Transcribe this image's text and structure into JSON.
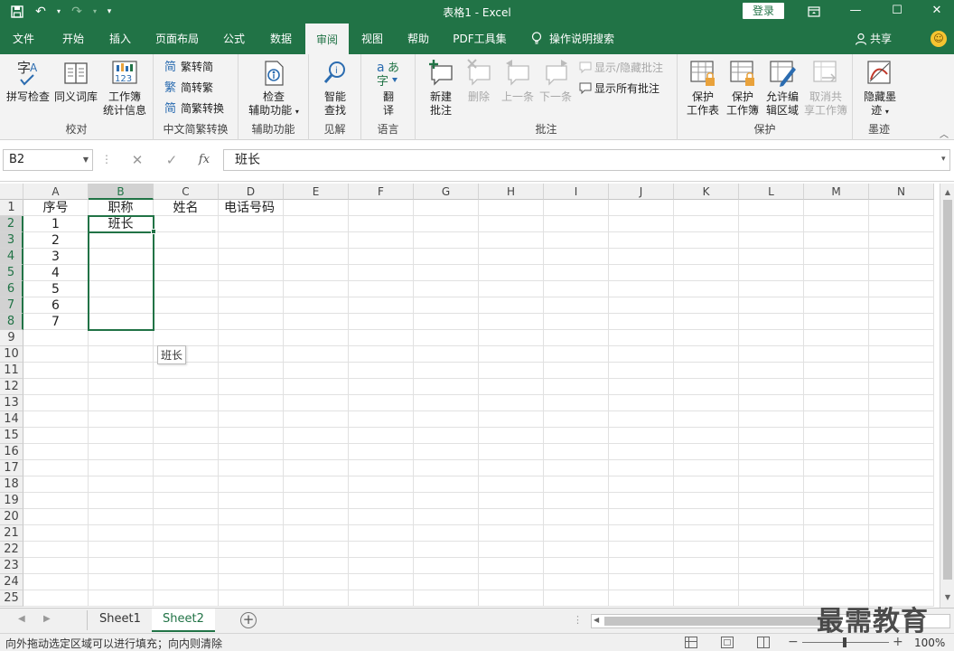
{
  "titlebar": {
    "title": "表格1 - Excel",
    "login": "登录"
  },
  "tabs": [
    {
      "label": "文件"
    },
    {
      "label": "开始"
    },
    {
      "label": "插入"
    },
    {
      "label": "页面布局"
    },
    {
      "label": "公式"
    },
    {
      "label": "数据"
    },
    {
      "label": "审阅",
      "active": true
    },
    {
      "label": "视图"
    },
    {
      "label": "帮助"
    },
    {
      "label": "PDF工具集"
    },
    {
      "label": "操作说明搜索"
    }
  ],
  "share": "共享",
  "ribbon": {
    "proofing": {
      "label": "校对",
      "spell1": "拼写检查",
      "thesaurus": "同义词库",
      "stats1": "工作簿",
      "stats2": "统计信息"
    },
    "chinese": {
      "label": "中文简繁转换",
      "to_trad": "繁转简",
      "to_simp": "简转繁",
      "convert": "简繁转换"
    },
    "access": {
      "label": "辅助功能",
      "check1": "检查",
      "check2": "辅助功能"
    },
    "insights": {
      "label": "见解",
      "smart1": "智能",
      "smart2": "查找"
    },
    "language": {
      "label": "语言",
      "translate1": "翻",
      "translate2": "译"
    },
    "comments": {
      "label": "批注",
      "new1": "新建",
      "new2": "批注",
      "delete": "删除",
      "prev": "上一条",
      "next": "下一条",
      "show_hide": "显示/隐藏批注",
      "show_all": "显示所有批注"
    },
    "protect": {
      "label": "保护",
      "sheet1": "保护",
      "sheet2": "工作表",
      "book1": "保护",
      "book2": "工作簿",
      "allow1": "允许编",
      "allow2": "辑区域",
      "unshare1": "取消共",
      "unshare2": "享工作簿"
    },
    "ink": {
      "label": "墨迹",
      "hide1": "隐藏墨",
      "hide2": "迹"
    }
  },
  "formula": {
    "namebox": "B2",
    "content": "班长",
    "fx": "fx"
  },
  "columns": [
    "A",
    "B",
    "C",
    "D",
    "E",
    "F",
    "G",
    "H",
    "I",
    "J",
    "K",
    "L",
    "M",
    "N"
  ],
  "rows": [
    "1",
    "2",
    "3",
    "4",
    "5",
    "6",
    "7",
    "8",
    "9",
    "10",
    "11",
    "12",
    "13",
    "14",
    "15",
    "16",
    "17",
    "18",
    "19",
    "20",
    "21",
    "22",
    "23",
    "24",
    "25"
  ],
  "cells": {
    "A1": "序号",
    "B1": "职称",
    "C1": "姓名",
    "D1": "电话号码",
    "A2": "1",
    "B2": "班长",
    "A3": "2",
    "A4": "3",
    "A5": "4",
    "A6": "5",
    "A7": "6",
    "A8": "7"
  },
  "fill_tooltip": "班长",
  "sheets": [
    {
      "name": "Sheet1"
    },
    {
      "name": "Sheet2",
      "active": true
    }
  ],
  "status": {
    "message": "向外拖动选定区域可以进行填充；向内则清除",
    "zoom": "100%"
  },
  "watermark": "最需教育",
  "colors": {
    "excel_green": "#217346"
  }
}
